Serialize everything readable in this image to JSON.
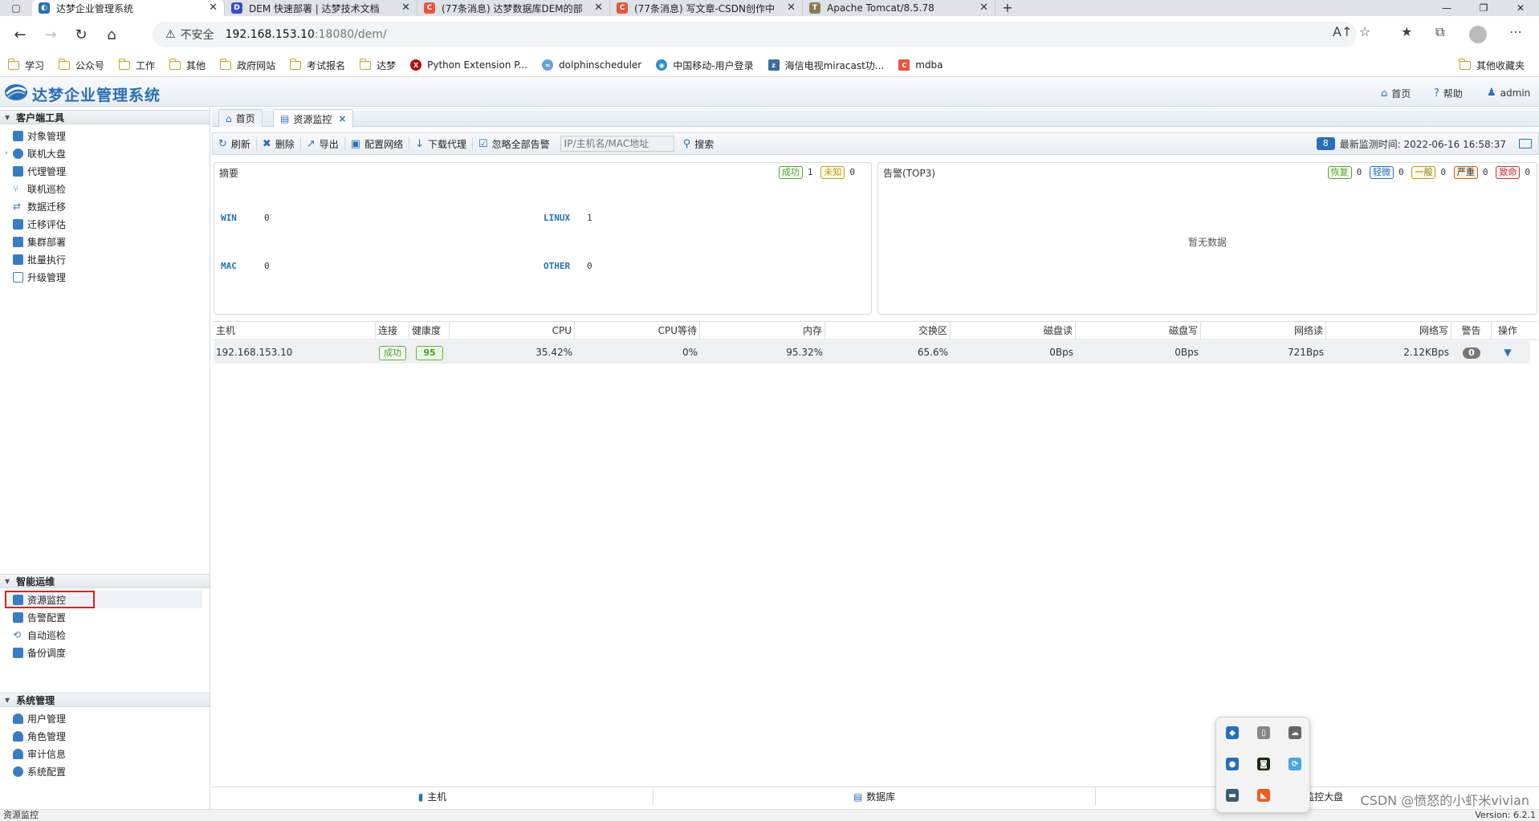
{
  "browser": {
    "tabs": [
      {
        "label": "达梦企业管理系统",
        "active": true
      },
      {
        "label": "DEM 快速部署 | 达梦技术文档"
      },
      {
        "label": "(77条消息) 达梦数据库DEM的部"
      },
      {
        "label": "(77条消息) 写文章-CSDN创作中"
      },
      {
        "label": "Apache Tomcat/8.5.78"
      }
    ],
    "security_label": "不安全",
    "url_host": "192.168.153.10",
    "url_rest": ":18080/dem/",
    "bookmarks": [
      "学习",
      "公众号",
      "工作",
      "其他",
      "政府网站",
      "考试报名",
      "达梦",
      "Python Extension P...",
      "dolphinscheduler",
      "中国移动-用户登录",
      "海信电视miracast功...",
      "mdba"
    ],
    "other_bookmarks": "其他收藏夹"
  },
  "app": {
    "title": "达梦企业管理系统",
    "home_link": "首页",
    "help_link": "帮助",
    "user": "admin"
  },
  "sidebar": {
    "client_tools": {
      "title": "客户端工具",
      "items": [
        "对象管理",
        "联机大盘",
        "代理管理",
        "联机巡检",
        "数据迁移",
        "迁移评估",
        "集群部署",
        "批量执行",
        "升级管理"
      ]
    },
    "smart_ops": {
      "title": "智能运维",
      "items": [
        "资源监控",
        "告警配置",
        "自动巡检",
        "备份调度"
      ]
    },
    "system": {
      "title": "系统管理",
      "items": [
        "用户管理",
        "角色管理",
        "审计信息",
        "系统配置"
      ]
    }
  },
  "main_tabs": [
    {
      "label": "首页"
    },
    {
      "label": "资源监控",
      "active": true
    }
  ],
  "toolbar": {
    "refresh": "刷新",
    "delete": "删除",
    "export": "导出",
    "config_network": "配置网络",
    "download_agent": "下载代理",
    "ignore_alerts": "忽略全部告警",
    "search_placeholder": "IP/主机名/MAC地址",
    "search": "搜索",
    "badge": "8",
    "last_monitor": "最新监测时间: 2022-06-16 16:58:37"
  },
  "summary": {
    "title": "摘要",
    "success_label": "成功",
    "success_count": "1",
    "unknown_label": "未知",
    "unknown_count": "0",
    "os": [
      {
        "name": "WIN",
        "count": "0"
      },
      {
        "name": "LINUX",
        "count": "1"
      },
      {
        "name": "MAC",
        "count": "0"
      },
      {
        "name": "OTHER",
        "count": "0"
      }
    ]
  },
  "alerts": {
    "title": "告警(TOP3)",
    "levels": [
      {
        "label": "恢复",
        "count": "0",
        "color": "#5a9e3a"
      },
      {
        "label": "轻微",
        "count": "0",
        "color": "#2a6fb5"
      },
      {
        "label": "一般",
        "count": "0",
        "color": "#b59a1a"
      },
      {
        "label": "严重",
        "count": "0",
        "color": "#b5651a"
      },
      {
        "label": "致命",
        "count": "0",
        "color": "#c23b3b"
      }
    ],
    "empty": "暂无数据"
  },
  "table": {
    "headers": [
      "主机",
      "连接",
      "健康度",
      "CPU",
      "CPU等待",
      "内存",
      "交换区",
      "磁盘读",
      "磁盘写",
      "网络读",
      "网络写",
      "警告",
      "操作"
    ],
    "rows": [
      {
        "host": "192.168.153.10",
        "connection": "成功",
        "health": "95",
        "cpu": "35.42%",
        "cpu_wait": "0%",
        "memory": "95.32%",
        "swap": "65.6%",
        "disk_read": "0Bps",
        "disk_write": "0Bps",
        "net_read": "721Bps",
        "net_write": "2.12KBps",
        "warnings": "0"
      }
    ]
  },
  "bottom_tabs": [
    "主机",
    "数据库",
    "监控大盘"
  ],
  "status": {
    "left": "资源监控",
    "watermark": "CSDN @愤怒的小虾米vivian",
    "version": "Version: 6.2.1"
  }
}
